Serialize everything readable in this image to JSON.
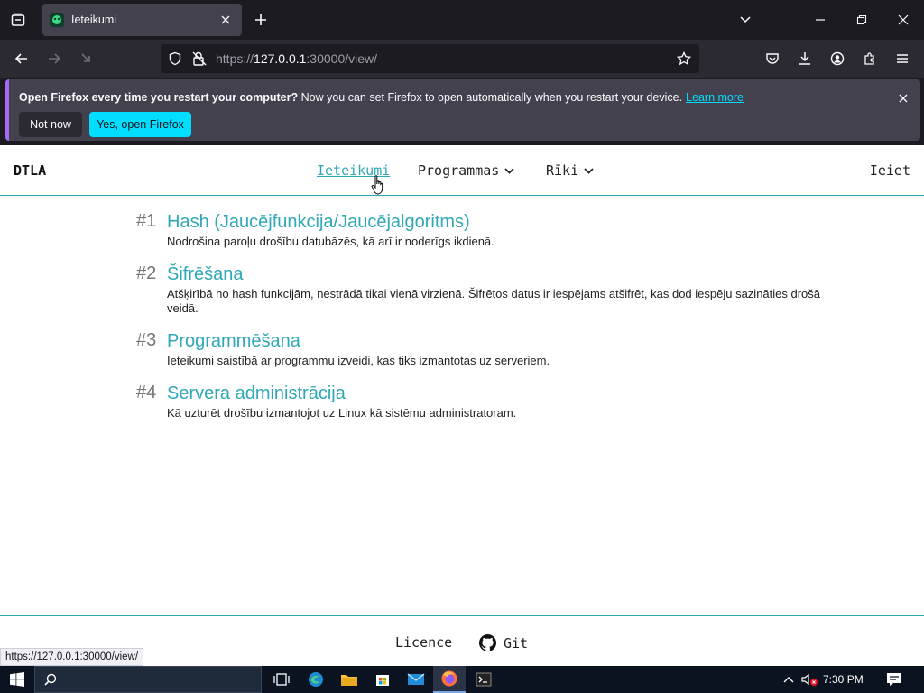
{
  "browser": {
    "tab": {
      "title": "Ieteikumi"
    },
    "url": {
      "prefix": "https://",
      "host": "127.0.0.1",
      "rest": ":30000/view/"
    },
    "notification": {
      "bold": "Open Firefox every time you restart your computer?",
      "text": "Now you can set Firefox to open automatically when you restart your device.",
      "link": "Learn more",
      "btn_dismiss": "Not now",
      "btn_accept": "Yes, open Firefox"
    },
    "status_url": "https://127.0.0.1:30000/view/"
  },
  "site": {
    "brand": "DTLA",
    "menu": [
      {
        "label": "Ieteikumi",
        "active": true
      },
      {
        "label": "Programmas",
        "dropdown": true
      },
      {
        "label": "Rīki",
        "dropdown": true
      }
    ],
    "login": "Ieiet",
    "articles": [
      {
        "num": "#1",
        "title": "Hash (Jaucējfunkcija/Jaucējalgoritms)",
        "desc": "Nodrošina paroļu drošību datubāzēs, kā arī ir noderīgs ikdienā."
      },
      {
        "num": "#2",
        "title": "Šifrēšana",
        "desc": "Atšķirībā no hash funkcijām, nestrādā tikai vienā virzienā. Šifrētos datus ir iespējams atšifrēt, kas dod iespēju sazināties drošā veidā."
      },
      {
        "num": "#3",
        "title": "Programmēšana",
        "desc": "Ieteikumi saistībā ar programmu izveidi, kas tiks izmantotas uz serveriem."
      },
      {
        "num": "#4",
        "title": "Servera administrācija",
        "desc": "Kā uzturēt drošību izmantojot uz Linux kā sistēmu administratoram."
      }
    ],
    "footer": {
      "licence": "Licence",
      "git": "Git"
    }
  },
  "taskbar": {
    "clock": "7:30 PM"
  },
  "colors": {
    "accent": "#2fa8b6",
    "firefox_cyan": "#00ddff"
  }
}
